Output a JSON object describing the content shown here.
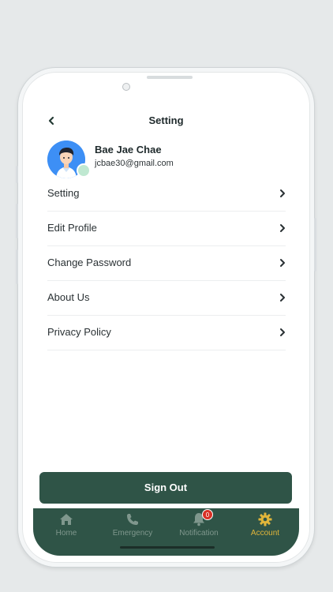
{
  "header": {
    "title": "Setting",
    "back_icon": "chevron-left-icon"
  },
  "profile": {
    "name": "Bae Jae Chae",
    "email": "jcbae30@gmail.com"
  },
  "menu": [
    {
      "label": "Setting",
      "icon": "chevron-right-icon"
    },
    {
      "label": "Edit Profile",
      "icon": "chevron-right-icon"
    },
    {
      "label": "Change Password",
      "icon": "chevron-right-icon"
    },
    {
      "label": "About Us",
      "icon": "chevron-right-icon"
    },
    {
      "label": "Privacy Policy",
      "icon": "chevron-right-icon"
    }
  ],
  "signout_label": "Sign Out",
  "tabs": [
    {
      "label": "Home",
      "icon": "home-icon"
    },
    {
      "label": "Emergency",
      "icon": "phone-icon"
    },
    {
      "label": "Notification",
      "icon": "bell-icon",
      "badge": "0"
    },
    {
      "label": "Account",
      "icon": "gear-icon",
      "active": true
    }
  ],
  "colors": {
    "primary": "#2f5447",
    "accent": "#e0b53a",
    "badge": "#d93025",
    "avatar_bg": "#3d8ff5"
  }
}
